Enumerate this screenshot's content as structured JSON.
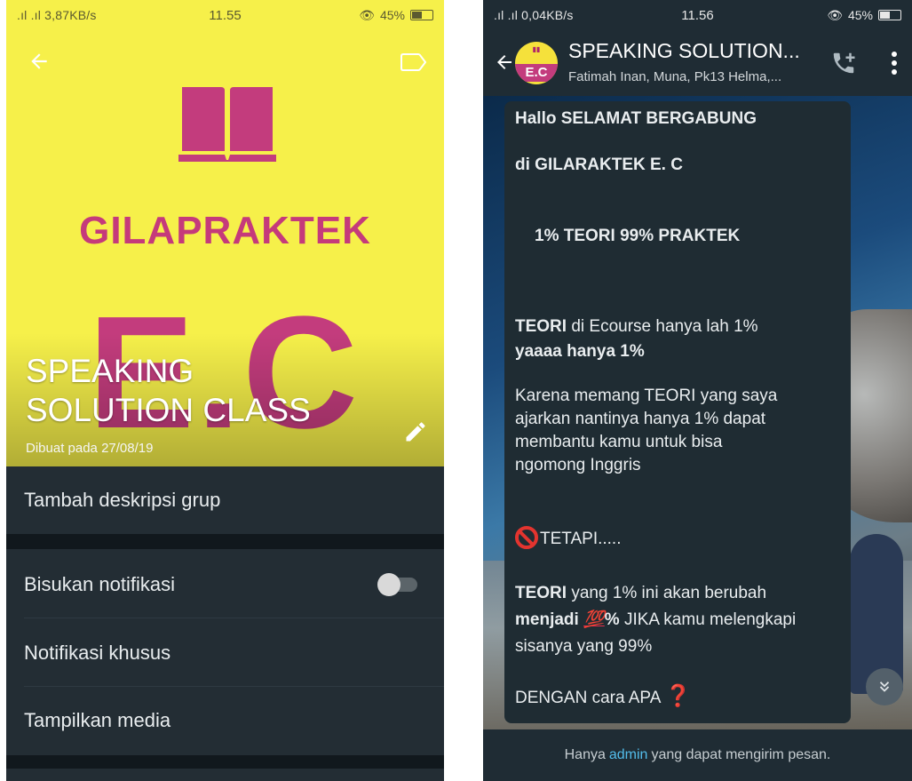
{
  "left_phone": {
    "status": {
      "network": ".ıl .ıl 3,87KB/s",
      "time": "11.55",
      "battery": "45%"
    },
    "brand_title": "GILAPRAKTEK",
    "brand_logo_letters": "E.C",
    "group_name_line1": "SPEAKING",
    "group_name_line2": "SOLUTION CLASS",
    "created": "Dibuat pada 27/08/19",
    "menu": {
      "add_description": "Tambah deskripsi grup",
      "mute_notifications": "Bisukan notifikasi",
      "custom_notifications": "Notifikasi khusus",
      "show_media": "Tampilkan media"
    },
    "icons": {
      "back": "back-arrow-icon",
      "label": "label-icon",
      "edit": "pencil-icon"
    },
    "colors": {
      "hero_bg": "#f6f04a",
      "brand": "#c53a7b",
      "panel_bg": "#232d34"
    }
  },
  "right_phone": {
    "status": {
      "network": ".ıl .ıl 0,04KB/s",
      "time": "11.56",
      "battery": "45%"
    },
    "chat": {
      "title": "SPEAKING SOLUTION...",
      "subtitle": "Fatimah Inan, Muna, Pk13 Helma,...",
      "avatar_text": "E.C"
    },
    "message": {
      "l1": "Hallo SELAMAT BERGABUNG",
      "l2": "di GILARAKTEK E. C",
      "l3": "1% TEORI   99% PRAKTEK",
      "l4_bold": "TEORI",
      "l4_rest": " di Ecourse  hanya lah 1%",
      "l5": "yaaaa hanya 1%",
      "l6": "Karena memang TEORI yang saya",
      "l7": "ajarkan nantinya hanya 1% dapat",
      "l8": "membantu kamu untuk bisa",
      "l9": "ngomong Inggris",
      "l10": "TETAPI.....",
      "l11_bold": "TEORI",
      "l11_rest": " yang 1% ini akan berubah",
      "l12_bold": "menjadi",
      "l12_100": "💯",
      "l12_pct": "%",
      "l12_rest": " JIKA kamu melengkapi",
      "l13": "sisanya yang 99%",
      "l14": "DENGAN cara APA",
      "l14_emoji": "❓"
    },
    "footer": {
      "before": "Hanya",
      "admin": "admin",
      "after": "yang dapat mengirim pesan."
    },
    "icons": {
      "back": "back-arrow-icon",
      "call": "add-call-icon",
      "more": "more-vertical-icon",
      "scroll": "double-chevron-down-icon"
    }
  }
}
